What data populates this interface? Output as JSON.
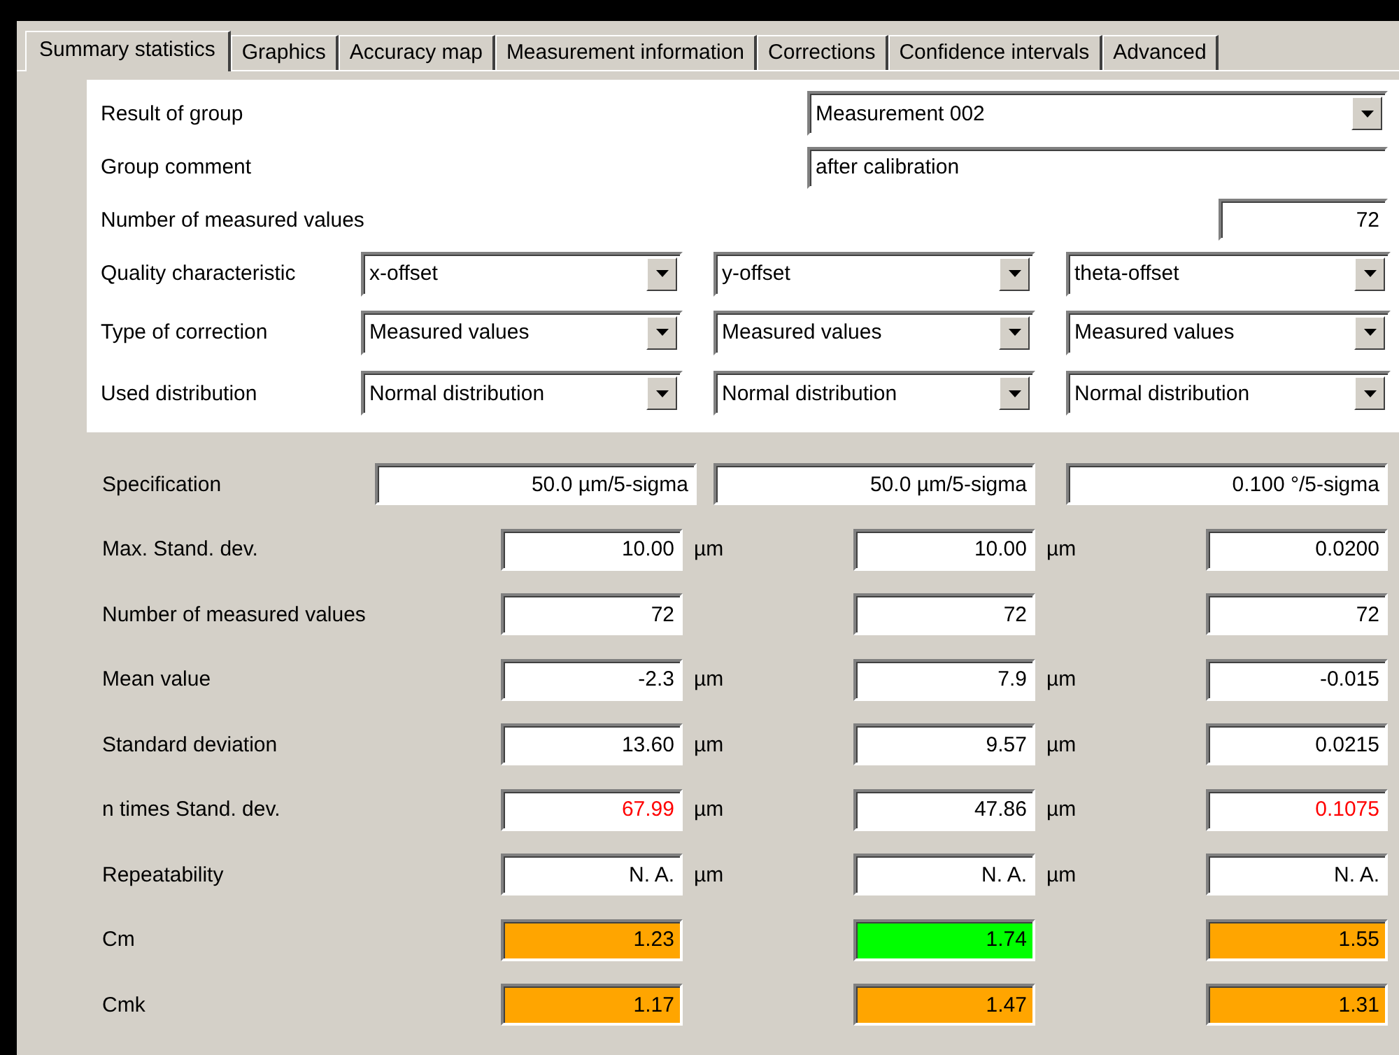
{
  "tabs": [
    {
      "label": "Summary statistics",
      "selected": true
    },
    {
      "label": "Graphics",
      "selected": false
    },
    {
      "label": "Accuracy map",
      "selected": false
    },
    {
      "label": "Measurement information",
      "selected": false
    },
    {
      "label": "Corrections",
      "selected": false
    },
    {
      "label": "Confidence intervals",
      "selected": false
    },
    {
      "label": "Advanced",
      "selected": false
    }
  ],
  "group": {
    "result_label": "Result of group",
    "result_value": "Measurement 002",
    "comment_label": "Group comment",
    "comment_value": "after calibration",
    "count_label": "Number of measured values",
    "count_value": "72"
  },
  "settings": [
    {
      "label": "Quality characteristic",
      "values": [
        "x-offset",
        "y-offset",
        "theta-offset"
      ]
    },
    {
      "label": "Type of correction",
      "values": [
        "Measured values",
        "Measured values",
        "Measured values"
      ]
    },
    {
      "label": "Used distribution",
      "values": [
        "Normal distribution",
        "Normal distribution",
        "Normal distribution"
      ]
    }
  ],
  "stats": [
    {
      "label": "Specification",
      "kind": "spec",
      "cells": [
        {
          "value": "50.0 µm/5-sigma"
        },
        {
          "value": "50.0 µm/5-sigma"
        },
        {
          "value": "0.100 °/5-sigma"
        }
      ]
    },
    {
      "label": "Max. Stand. dev.",
      "kind": "value",
      "cells": [
        {
          "value": "10.00",
          "unit": "µm"
        },
        {
          "value": "10.00",
          "unit": "µm"
        },
        {
          "value": "0.0200"
        }
      ]
    },
    {
      "label": "Number of measured values",
      "kind": "value",
      "cells": [
        {
          "value": "72"
        },
        {
          "value": "72"
        },
        {
          "value": "72"
        }
      ]
    },
    {
      "label": "Mean value",
      "kind": "value",
      "cells": [
        {
          "value": "-2.3",
          "unit": "µm"
        },
        {
          "value": "7.9",
          "unit": "µm"
        },
        {
          "value": "-0.015"
        }
      ]
    },
    {
      "label": "Standard deviation",
      "kind": "value",
      "cells": [
        {
          "value": "13.60",
          "unit": "µm"
        },
        {
          "value": "9.57",
          "unit": "µm"
        },
        {
          "value": "0.0215"
        }
      ]
    },
    {
      "label": "n times Stand. dev.",
      "kind": "value",
      "cells": [
        {
          "value": "67.99",
          "unit": "µm",
          "exceeded": true
        },
        {
          "value": "47.86",
          "unit": "µm",
          "exceeded": false
        },
        {
          "value": "0.1075",
          "exceeded": true
        }
      ]
    },
    {
      "label": "Repeatability",
      "kind": "value",
      "cells": [
        {
          "value": "N. A.",
          "unit": "µm"
        },
        {
          "value": "N. A.",
          "unit": "µm"
        },
        {
          "value": "N. A."
        }
      ]
    },
    {
      "label": "Cm",
      "kind": "capability",
      "cells": [
        {
          "value": "1.23",
          "color": "#ffa500"
        },
        {
          "value": "1.74",
          "color": "#00ff00"
        },
        {
          "value": "1.55",
          "color": "#ffa500"
        }
      ]
    },
    {
      "label": "Cmk",
      "kind": "capability",
      "cells": [
        {
          "value": "1.17",
          "color": "#ffa500"
        },
        {
          "value": "1.47",
          "color": "#ffa500"
        },
        {
          "value": "1.31",
          "color": "#ffa500"
        }
      ]
    }
  ]
}
